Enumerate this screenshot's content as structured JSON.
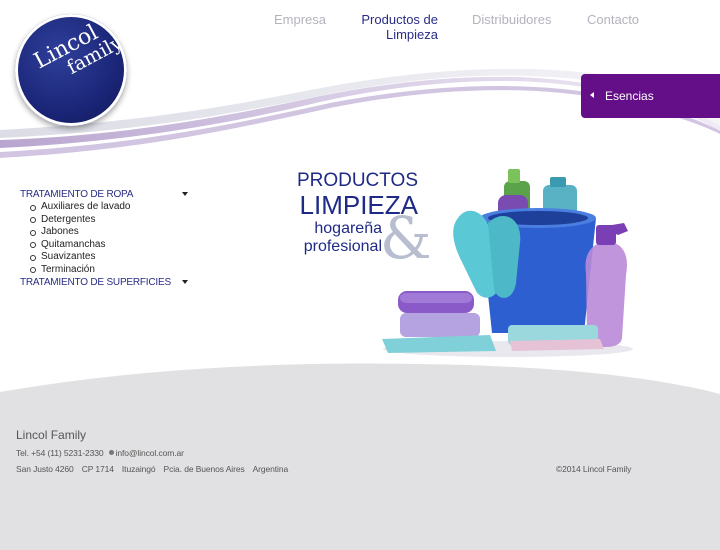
{
  "logo": {
    "line1": "Lincol",
    "line2": "family"
  },
  "nav": {
    "items": [
      {
        "label": "Empresa"
      },
      {
        "label_line1": "Productos de",
        "label_line2": "Limpieza"
      },
      {
        "label": "Distribuidores"
      },
      {
        "label": "Contacto"
      }
    ],
    "active_color": "#2a2c86",
    "inactive_color": "#b3b3bd"
  },
  "esencias": {
    "label": "Esencias",
    "color": "#640f87"
  },
  "sidebar": {
    "categories": [
      {
        "label": "Tratamiento de ropa",
        "items": [
          "Auxiliares de lavado",
          "Detergentes",
          "Jabones",
          "Quitamanchas",
          "Suavizantes",
          "Terminación"
        ]
      },
      {
        "label": "Tratamiento de superficies",
        "items": []
      }
    ]
  },
  "hero": {
    "line1": "PRODUCTOS",
    "line2": "LIMPIEZA",
    "line3": "hogareña",
    "line4": "profesional",
    "ampersand": "&",
    "text_color": "#1f2a86"
  },
  "footer": {
    "brand": "Lincol Family",
    "phone": "Tel. +54 (11) 5231-2330",
    "email": "info@lincol.com.ar",
    "address": [
      "San Justo 4260",
      "CP 1714",
      "Ituzaingó",
      "Pcia. de Buenos Aires",
      "Argentina"
    ],
    "copyright": "©2014 Lincol Family",
    "bg_color": "#e1e1e3"
  }
}
